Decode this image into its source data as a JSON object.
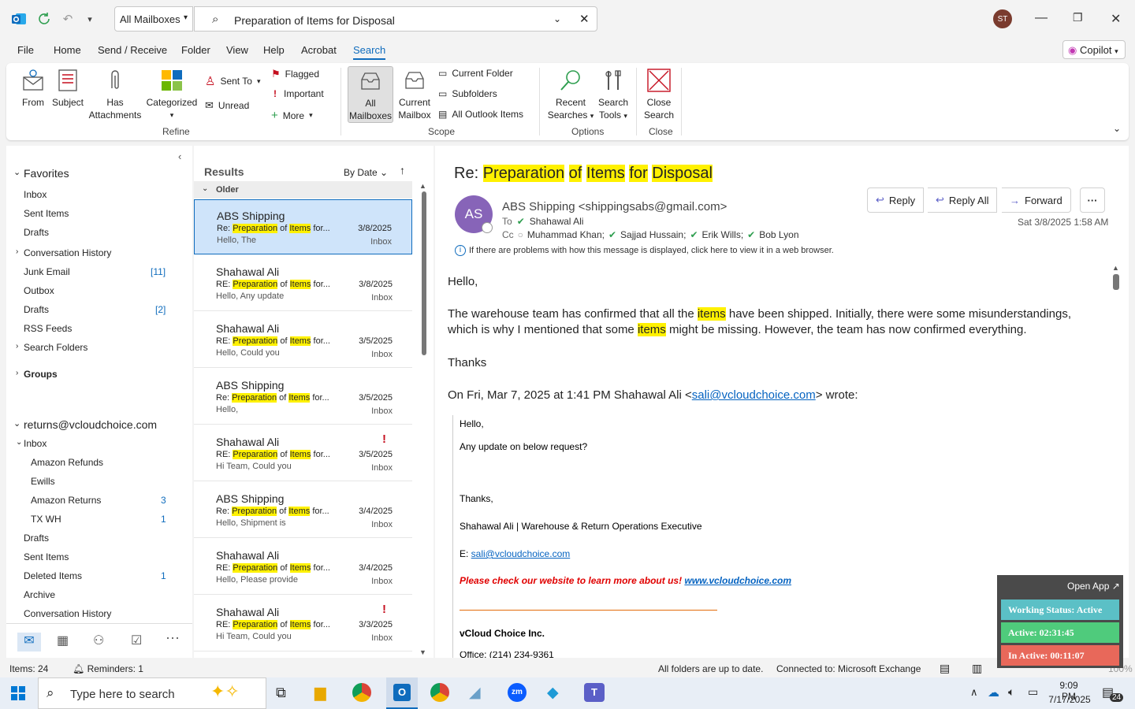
{
  "titlebar": {
    "mailbox_scope": "All Mailboxes",
    "search_query": "Preparation of Items for Disposal",
    "avatar_initials": "ST"
  },
  "menu": {
    "items": [
      "File",
      "Home",
      "Send / Receive",
      "Folder",
      "View",
      "Help",
      "Acrobat",
      "Search"
    ],
    "active": "Search",
    "copilot": "Copilot"
  },
  "ribbon": {
    "refine": {
      "from": "From",
      "subject": "Subject",
      "has_attachments_1": "Has",
      "has_attachments_2": "Attachments",
      "categorized": "Categorized",
      "sent_to": "Sent To",
      "unread": "Unread",
      "flagged": "Flagged",
      "important": "Important",
      "more": "More",
      "label": "Refine"
    },
    "scope": {
      "all_mailboxes_1": "All",
      "all_mailboxes_2": "Mailboxes",
      "current_mailbox_1": "Current",
      "current_mailbox_2": "Mailbox",
      "current_folder": "Current Folder",
      "subfolders": "Subfolders",
      "all_outlook_items": "All Outlook Items",
      "label": "Scope"
    },
    "options": {
      "recent_searches_1": "Recent",
      "recent_searches_2": "Searches",
      "search_tools_1": "Search",
      "search_tools_2": "Tools",
      "label": "Options"
    },
    "close": {
      "close_search_1": "Close",
      "close_search_2": "Search",
      "label": "Close"
    }
  },
  "leftnav": {
    "favorites": "Favorites",
    "fav_items": [
      "Inbox",
      "Sent Items",
      "Drafts"
    ],
    "items": [
      {
        "label": "Conversation History",
        "count": ""
      },
      {
        "label": "Junk Email",
        "count": "[11]"
      },
      {
        "label": "Outbox",
        "count": ""
      },
      {
        "label": "Drafts",
        "count": "[2]"
      },
      {
        "label": "RSS Feeds",
        "count": ""
      },
      {
        "label": "Search Folders",
        "count": ""
      }
    ],
    "groups": "Groups",
    "account": "returns@vcloudchoice.com",
    "inbox": "Inbox",
    "subfolders": [
      {
        "label": "Amazon Refunds",
        "count": ""
      },
      {
        "label": "Ewills",
        "count": ""
      },
      {
        "label": "Amazon Returns",
        "count": "3"
      },
      {
        "label": "TX WH",
        "count": "1"
      }
    ],
    "folders": [
      {
        "label": "Drafts",
        "count": ""
      },
      {
        "label": "Sent Items",
        "count": ""
      },
      {
        "label": "Deleted Items",
        "count": "1"
      },
      {
        "label": "Archive",
        "count": ""
      },
      {
        "label": "Conversation History",
        "count": ""
      }
    ]
  },
  "results": {
    "title": "Results",
    "sort": "By Date",
    "group": "Older",
    "subject_prefix_re": "Re: ",
    "subject_prefix_RE": "RE: ",
    "messages": [
      {
        "from": "ABS Shipping",
        "prefix": "Re: ",
        "date": "3/8/2025",
        "folder": "Inbox",
        "preview": "Hello,  The",
        "flag": ""
      },
      {
        "from": "Shahawal Ali",
        "prefix": "RE: ",
        "date": "3/8/2025",
        "folder": "Inbox",
        "preview": "Hello,  Any update",
        "flag": ""
      },
      {
        "from": "Shahawal Ali",
        "prefix": "RE: ",
        "date": "3/5/2025",
        "folder": "Inbox",
        "preview": "Hello,  Could you",
        "flag": ""
      },
      {
        "from": "ABS Shipping",
        "prefix": "Re: ",
        "date": "3/5/2025",
        "folder": "Inbox",
        "preview": "Hello,",
        "flag": ""
      },
      {
        "from": "Shahawal Ali",
        "prefix": "RE: ",
        "date": "3/5/2025",
        "folder": "Inbox",
        "preview": "Hi Team,  Could you",
        "flag": "!"
      },
      {
        "from": "ABS Shipping",
        "prefix": "Re: ",
        "date": "3/4/2025",
        "folder": "Inbox",
        "preview": "Hello,  Shipment is",
        "flag": ""
      },
      {
        "from": "Shahawal Ali",
        "prefix": "RE: ",
        "date": "3/4/2025",
        "folder": "Inbox",
        "preview": "Hello,  Please provide",
        "flag": ""
      },
      {
        "from": "Shahawal Ali",
        "prefix": "RE: ",
        "date": "3/3/2025",
        "folder": "Inbox",
        "preview": "Hi Team,  Could you",
        "flag": "!"
      }
    ],
    "subj_words": {
      "w1": "Preparation",
      "w2": " of ",
      "w3": "Items",
      "w4": " for..."
    }
  },
  "reading": {
    "subject_prefix": "Re: ",
    "subject_words": {
      "w1": "Preparation",
      "w2": "of",
      "w3": "Items",
      "w4": "for",
      "w5": "Disposal"
    },
    "sender_initials": "AS",
    "sender": "ABS Shipping <shippingsabs@gmail.com>",
    "to_label": "To",
    "to": "Shahawal Ali",
    "cc_label": "Cc",
    "cc": [
      "Muhammad Khan;",
      "Sajjad Hussain;",
      "Erik Wills;",
      "Bob Lyon"
    ],
    "date": "Sat 3/8/2025 1:58 AM",
    "reply": "Reply",
    "reply_all": "Reply All",
    "forward": "Forward",
    "info": "If there are problems with how this message is displayed, click here to view it in a web browser.",
    "greeting": "Hello,",
    "p1_a": "The warehouse team has confirmed that all the ",
    "p1_hl1": "items",
    "p1_b": " have been shipped. Initially, there were some misunderstandings,",
    "p1_c": "which is why I mentioned that some ",
    "p1_hl2": "items",
    "p1_d": " might be missing. However, the team has now confirmed everything.",
    "thanks": "Thanks",
    "quote_a": "On Fri, Mar 7, 2025 at 1:41 PM Shahawal Ali <",
    "quote_email": "sali@vcloudchoice.com",
    "quote_b": "> wrote:",
    "q_hello": "Hello,",
    "q_update": "Any update on below request?",
    "q_thanks": "Thanks,",
    "q_sig": "Shahawal Ali | Warehouse & Return Operations Executive",
    "q_e": "E: ",
    "q_email": "sali@vcloudchoice.com",
    "q_promo": "Please check our website to learn more about us! ",
    "q_site": "www.vcloudchoice.com",
    "q_company": "vCloud Choice Inc.",
    "q_office": "Office: (214) 234-9361"
  },
  "widget": {
    "open_app": "Open App ↗",
    "status": "Working Status: Active",
    "active": "Active: 02:31:45",
    "inactive": "In Active: 00:11:07"
  },
  "statusbar": {
    "items": "Items: 24",
    "reminders": "Reminders: 1",
    "sync": "All folders are up to date.",
    "connection": "Connected to: Microsoft Exchange",
    "zoom": "100%"
  },
  "taskbar": {
    "search_placeholder": "Type here to search",
    "time": "9:09 PM",
    "date": "7/17/2025",
    "notifications": "24"
  },
  "colors": {
    "accent": "#0f6cbd",
    "highlight": "#fff100",
    "flag": "#c50f1f",
    "avatar": "#8764b8",
    "widget_status": "#5bc0c6",
    "widget_active": "#4fcb7c",
    "widget_inactive": "#e8685a"
  }
}
